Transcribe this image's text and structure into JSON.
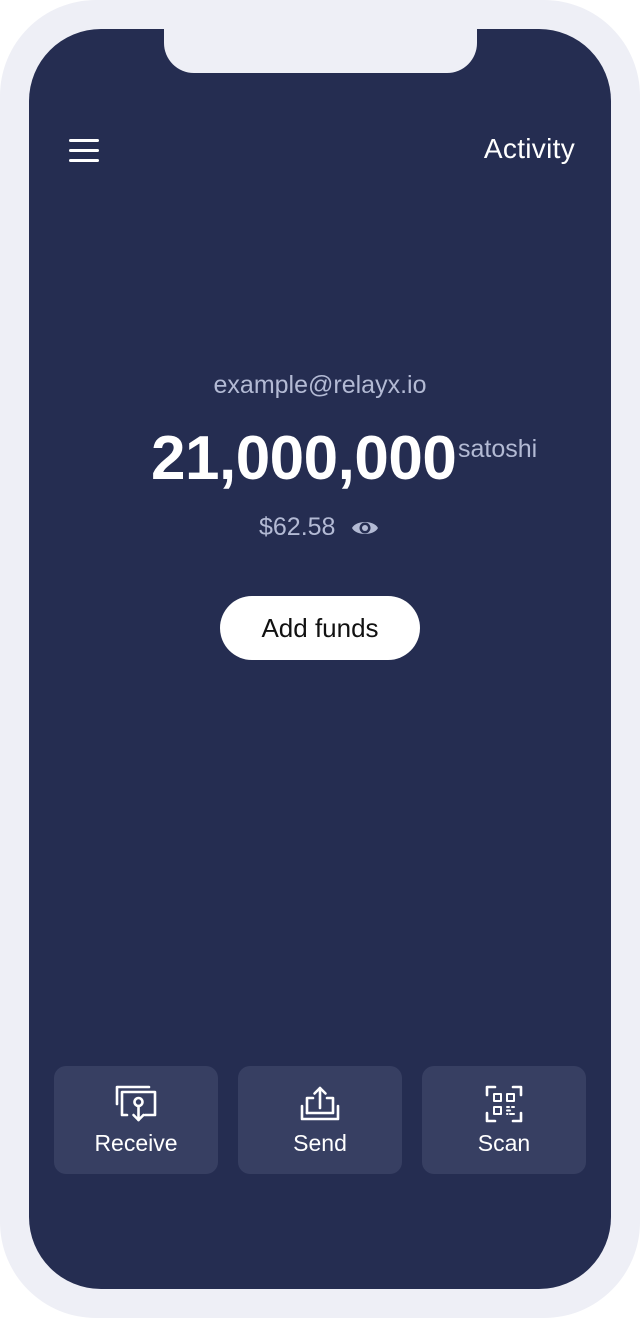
{
  "header": {
    "menu_icon": "hamburger-menu-icon",
    "activity_label": "Activity"
  },
  "wallet": {
    "email": "example@relayx.io",
    "balance": "21,000,000",
    "unit": "satoshi",
    "fiat_value": "$62.58",
    "visibility_icon": "eye-icon"
  },
  "add_funds_label": "Add funds",
  "actions": [
    {
      "label": "Receive",
      "icon": "receive-icon"
    },
    {
      "label": "Send",
      "icon": "send-icon"
    },
    {
      "label": "Scan",
      "icon": "qr-scan-icon"
    }
  ],
  "colors": {
    "background": "#252d51",
    "action_tile": "#373f62",
    "muted_text": "#b3bad4",
    "frame": "#eeeff6"
  }
}
